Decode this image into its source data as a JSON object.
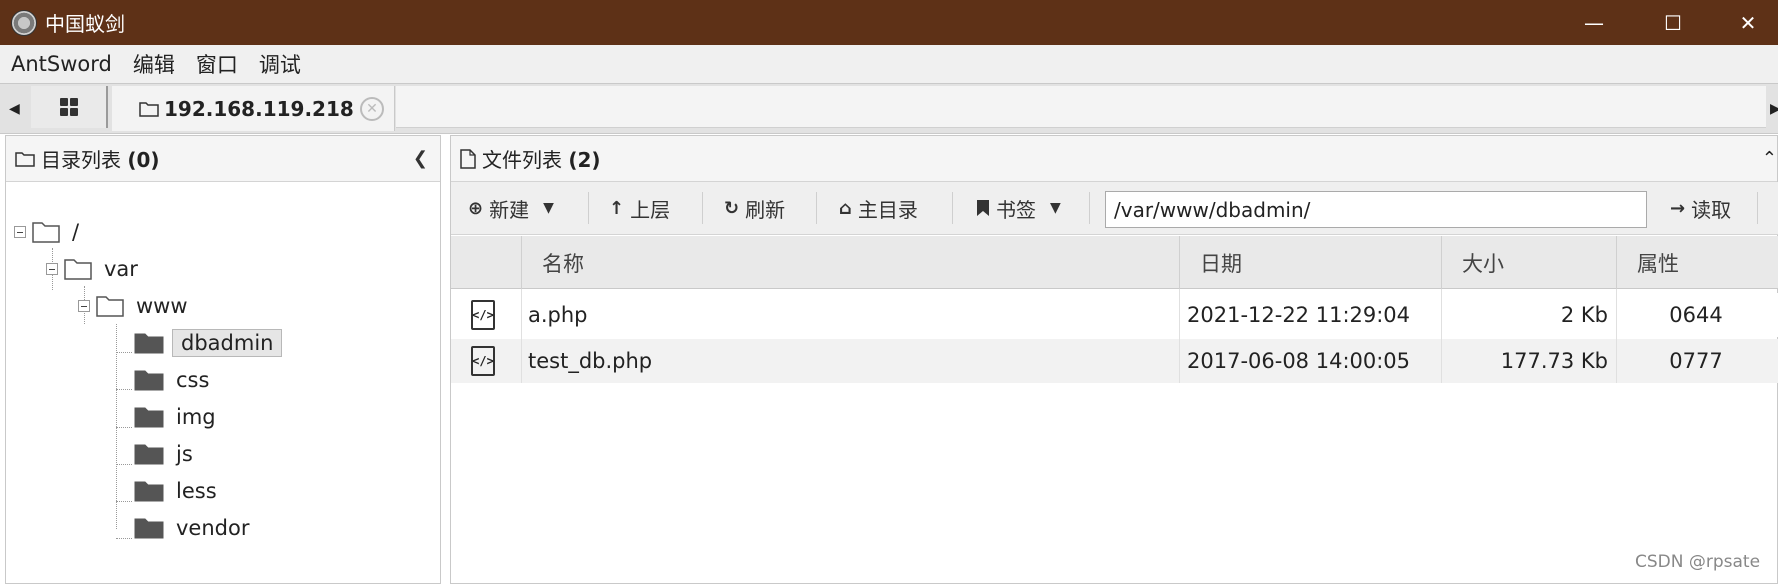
{
  "window": {
    "title": "中国蚁剑",
    "minimize_icon": "minimize-icon",
    "maximize_icon": "maximize-icon",
    "close_icon": "close-icon"
  },
  "menu": [
    "AntSword",
    "编辑",
    "窗口",
    "调试"
  ],
  "tabs": {
    "home_icon": "grid-icon",
    "active_tab_label": "192.168.119.218"
  },
  "left_panel": {
    "title": "目录列表",
    "count": "(0)",
    "tree": [
      {
        "label": "/",
        "level": 0,
        "expanded": true,
        "selected": false
      },
      {
        "label": "var",
        "level": 1,
        "expanded": true,
        "selected": false
      },
      {
        "label": "www",
        "level": 2,
        "expanded": true,
        "selected": false
      },
      {
        "label": "dbadmin",
        "level": 3,
        "expanded": false,
        "selected": true,
        "filled": true
      },
      {
        "label": "css",
        "level": 3,
        "expanded": false,
        "selected": false,
        "filled": true
      },
      {
        "label": "img",
        "level": 3,
        "expanded": false,
        "selected": false,
        "filled": true
      },
      {
        "label": "js",
        "level": 3,
        "expanded": false,
        "selected": false,
        "filled": true
      },
      {
        "label": "less",
        "level": 3,
        "expanded": false,
        "selected": false,
        "filled": true
      },
      {
        "label": "vendor",
        "level": 3,
        "expanded": false,
        "selected": false,
        "filled": true
      }
    ]
  },
  "right_panel": {
    "title": "文件列表",
    "count": "(2)",
    "toolbar": {
      "new_label": "新建",
      "up_label": "上层",
      "refresh_label": "刷新",
      "home_label": "主目录",
      "bookmark_label": "书签",
      "path_value": "/var/www/dbadmin/",
      "read_label": "读取"
    },
    "columns": [
      "名称",
      "日期",
      "大小",
      "属性"
    ],
    "files": [
      {
        "name": "a.php",
        "date": "2021-12-22 11:29:04",
        "size": "2 Kb",
        "perm": "0644"
      },
      {
        "name": "test_db.php",
        "date": "2017-06-08 14:00:05",
        "size": "177.73 Kb",
        "perm": "0777"
      }
    ]
  },
  "watermark": "CSDN @rpsate",
  "colors": {
    "titlebar": "#5e3117",
    "row_alt": "#f2f2f2"
  }
}
